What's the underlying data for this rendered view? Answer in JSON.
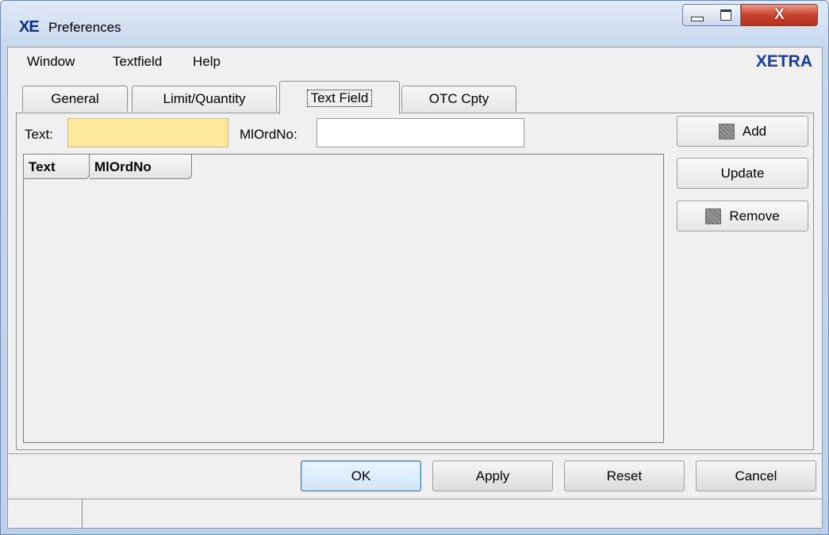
{
  "window": {
    "app_icon_text": "XE",
    "title": "Preferences",
    "close_glyph": "X"
  },
  "menubar": {
    "items": [
      {
        "label": "Window"
      },
      {
        "label": "Textfield"
      },
      {
        "label": "Help"
      }
    ],
    "brand": "XETRA"
  },
  "tabs": [
    {
      "label": "General",
      "active": false
    },
    {
      "label": "Limit/Quantity",
      "active": false
    },
    {
      "label": "Text Field",
      "active": true
    },
    {
      "label": "OTC Cpty",
      "active": false
    }
  ],
  "form": {
    "text_label": "Text:",
    "text_value": "",
    "mlordno_label": "MlOrdNo:",
    "mlordno_value": ""
  },
  "table": {
    "columns": [
      "Text",
      "MlOrdNo"
    ],
    "rows": []
  },
  "side_buttons": {
    "add": "Add",
    "update": "Update",
    "remove": "Remove"
  },
  "footer_buttons": {
    "ok": "OK",
    "apply": "Apply",
    "reset": "Reset",
    "cancel": "Cancel"
  },
  "status": {
    "cell1": "",
    "cell2": ""
  },
  "colors": {
    "brand": "#1a3d9c",
    "text_field_bg": "#fce79c",
    "default_button": "#3c7fb1"
  },
  "icons": {
    "add": "add-icon",
    "remove": "remove-icon"
  }
}
